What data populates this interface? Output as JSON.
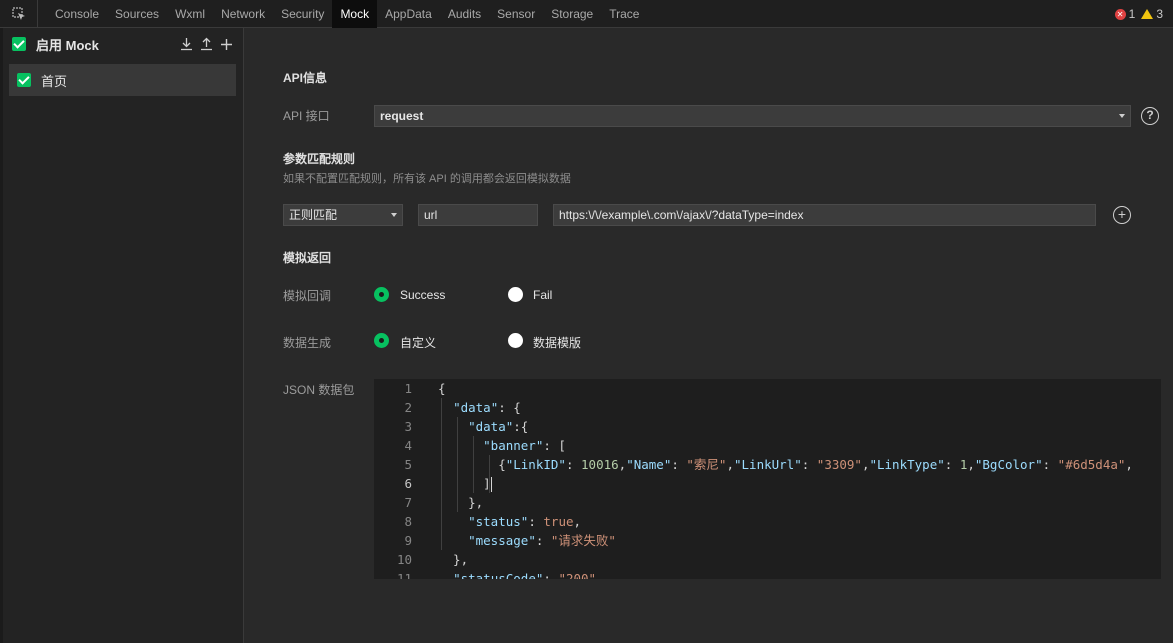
{
  "tabs": [
    "Console",
    "Sources",
    "Wxml",
    "Network",
    "Security",
    "Mock",
    "AppData",
    "Audits",
    "Sensor",
    "Storage",
    "Trace"
  ],
  "active_tab": "Mock",
  "status": {
    "errors": "1",
    "warnings": "3"
  },
  "left": {
    "enable_label": "启用 Mock",
    "items": [
      {
        "label": "首页"
      }
    ]
  },
  "api_info": {
    "title": "API信息",
    "api_label": "API 接口",
    "api_value": "request"
  },
  "match": {
    "title": "参数匹配规则",
    "hint": "如果不配置匹配规则，所有该 API 的调用都会返回模拟数据",
    "mode": "正则匹配",
    "key": "url",
    "value": "https:\\/\\/example\\.com\\/ajax\\/?dataType=index"
  },
  "mock_return": {
    "title": "模拟返回",
    "callback_label": "模拟回调",
    "callback_options": [
      "Success",
      "Fail"
    ],
    "generate_label": "数据生成",
    "generate_options": [
      "自定义",
      "数据模版"
    ],
    "json_label": "JSON 数据包"
  },
  "editor": {
    "line_numbers": [
      "1",
      "2",
      "3",
      "4",
      "5",
      "6",
      "7",
      "8",
      "9",
      "10",
      "11"
    ],
    "current_line": "6"
  },
  "colors": {
    "accent": "#07c160",
    "bg": "#292929",
    "editor_bg": "#1e1e1e"
  }
}
